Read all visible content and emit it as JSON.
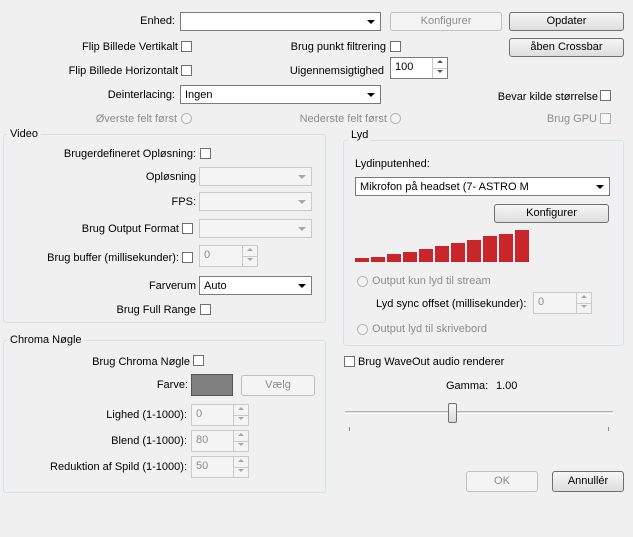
{
  "top": {
    "enhed_label": "Enhed:",
    "enhed_value": "",
    "konfigurer_label": "Konfigurer",
    "opdater_label": "Opdater",
    "flip_vertical_label": "Flip Billede Vertikalt",
    "point_filter_label": "Brug punkt filtrering",
    "crossbar_label": "åben Crossbar",
    "flip_horizontal_label": "Flip Billede Horizontalt",
    "opacity_label": "Uigennemsigtighed",
    "opacity_value": "100",
    "deinterlacing_label": "Deinterlacing:",
    "deinterlacing_value": "Ingen",
    "keep_size_label": "Bevar kilde størrelse",
    "top_field_label": "Øverste felt først",
    "bottom_field_label": "Nederste felt først",
    "use_gpu_label": "Brug GPU"
  },
  "video": {
    "title": "Video",
    "custom_res_label": "Brugerdefineret Opløsning:",
    "resolution_label": "Opløsning",
    "fps_label": "FPS:",
    "output_format_label": "Brug Output Format",
    "buffer_label": "Brug buffer (millisekunder):",
    "buffer_value": "0",
    "colorspace_label": "Farverum",
    "colorspace_value": "Auto",
    "full_range_label": "Brug Full Range"
  },
  "audio": {
    "title": "Lyd",
    "input_label": "Lydinputenhed:",
    "input_value": "Mikrofon på headset (7- ASTRO M",
    "configure_label": "Konfigurer",
    "level_bars": [
      0.12,
      0.17,
      0.25,
      0.32,
      0.42,
      0.5,
      0.6,
      0.7,
      0.8,
      0.88,
      1.0
    ],
    "bar_color": "#c8262a",
    "output_stream_label": "Output kun lyd til stream",
    "sync_offset_label": "Lyd sync offset (millisekunder):",
    "sync_offset_value": "0",
    "output_desktop_label": "Output lyd til skrivebord",
    "waveout_label": "Brug WaveOut audio renderer",
    "gamma_label": "Gamma:",
    "gamma_value": "1.00",
    "gamma_slider_position": 0.4
  },
  "chroma": {
    "title": "Chroma Nøgle",
    "use_label": "Brug Chroma Nøgle",
    "color_label": "Farve:",
    "color_value": "#808080",
    "choose_label": "Vælg",
    "similarity_label": "Lighed (1-1000):",
    "similarity_value": "0",
    "blend_label": "Blend (1-1000):",
    "blend_value": "80",
    "spill_label": "Reduktion af Spild (1-1000):",
    "spill_value": "50"
  },
  "footer": {
    "ok_label": "OK",
    "cancel_label": "Annullér"
  }
}
